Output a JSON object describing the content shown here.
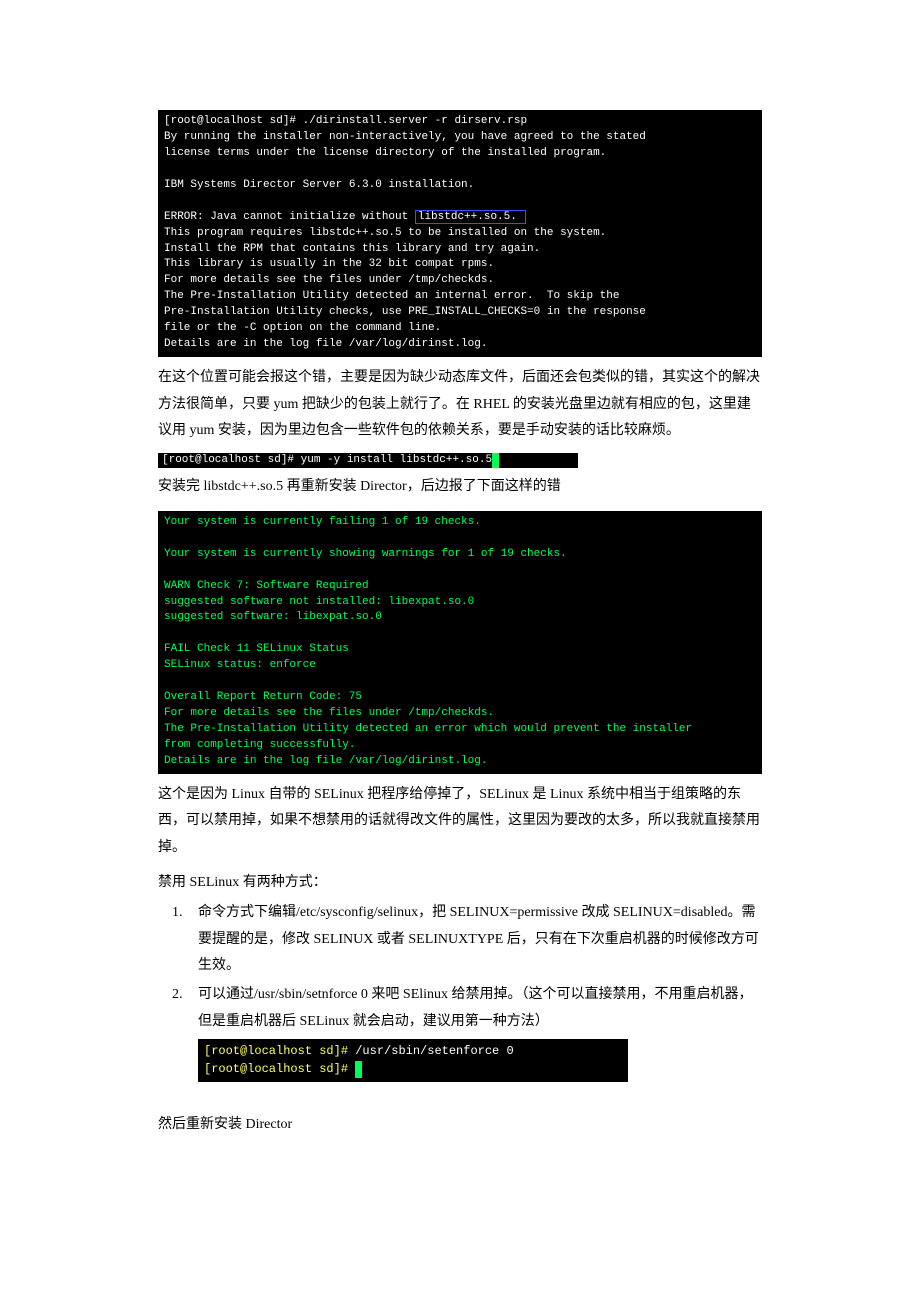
{
  "term1": {
    "line1": "[root@localhost sd]# ./dirinstall.server -r dirserv.rsp",
    "line2": "By running the installer non-interactively, you have agreed to the stated",
    "line3": "license terms under the license directory of the installed program.",
    "line5": "IBM Systems Director Server 6.3.0 installation.",
    "line7a": "ERROR: Java cannot initialize without ",
    "line7b": "libstdc++.so.5. ",
    "line8": "This program requires libstdc++.so.5 to be installed on the system.",
    "line9": "Install the RPM that contains this library and try again.",
    "line10": "This library is usually in the 32 bit compat rpms.",
    "line11": "For more details see the files under /tmp/checkds.",
    "line12": "The Pre-Installation Utility detected an internal error.  To skip the",
    "line13": "Pre-Installation Utility checks, use PRE_INSTALL_CHECKS=0 in the response",
    "line14": "file or the -C option on the command line.",
    "line15": "Details are in the log file /var/log/dirinst.log."
  },
  "para1": "在这个位置可能会报这个错，主要是因为缺少动态库文件，后面还会包类似的错，其实这个的解决方法很简单，只要 yum 把缺少的包装上就行了。在 RHEL 的安装光盘里边就有相应的包，这里建议用 yum 安装，因为里边包含一些软件包的依赖关系，要是手动安装的话比较麻烦。",
  "term2": {
    "cmd": "[root@localhost sd]# yum -y install libstdc++.so.5"
  },
  "para2": "安装完 libstdc++.so.5 再重新安装 Director，后边报了下面这样的错",
  "term3": {
    "l1": "Your system is currently failing 1 of 19 checks.",
    "l2": "Your system is currently showing warnings for 1 of 19 checks.",
    "l3": "WARN Check 7: Software Required",
    "l4": "suggested software not installed: libexpat.so.0",
    "l5": "suggested software: libexpat.so.0",
    "l6": "FAIL Check 11 SELinux Status",
    "l7": "SELinux status: enforce",
    "l8": "Overall Report Return Code: 75",
    "l9": "For more details see the files under /tmp/checkds.",
    "l10": "The Pre-Installation Utility detected an error which would prevent the installer",
    "l11": "from completing successfully.",
    "l12": "Details are in the log file /var/log/dirinst.log."
  },
  "para3": "这个是因为 Linux 自带的 SELinux 把程序给停掉了，SELinux 是 Linux 系统中相当于组策略的东西，可以禁用掉，如果不想禁用的话就得改文件的属性，这里因为要改的太多，所以我就直接禁用掉。",
  "para4": "禁用 SELinux 有两种方式：",
  "list": {
    "item1_num": "1.",
    "item1_text": "命令方式下编辑/etc/sysconfig/selinux，把 SELINUX=permissive 改成 SELINUX=disabled。需要提醒的是，修改 SELINUX 或者 SELINUXTYPE 后，只有在下次重启机器的时候修改方可生效。",
    "item2_num": "2.",
    "item2_text": "可以通过/usr/sbin/setnforce 0 来吧 SElinux 给禁用掉。（这个可以直接禁用，不用重启机器，但是重启机器后 SELinux 就会启动，建议用第一种方法）"
  },
  "term4": {
    "l1a": "[root@localhost sd]#",
    "l1b": " /usr/sbin/setenforce 0",
    "l2a": "[root@localhost sd]# "
  },
  "para5": "然后重新安装 Director"
}
